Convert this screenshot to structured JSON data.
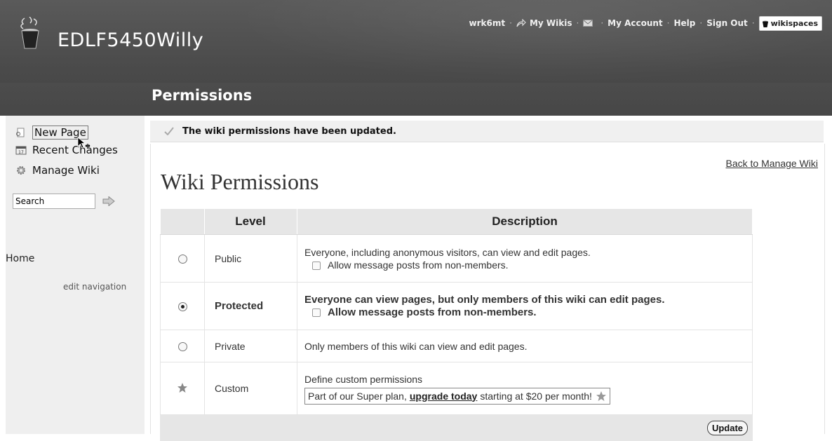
{
  "header": {
    "site_title": "EDLF5450Willy",
    "page_heading": "Permissions",
    "user_nav": {
      "username": "wrk6mt",
      "my_wikis": "My Wikis",
      "my_account": "My Account",
      "help": "Help",
      "sign_out": "Sign Out",
      "brand": "wikispaces"
    }
  },
  "sidebar": {
    "new_page": "New Page",
    "recent_changes": "Recent Changes",
    "manage_wiki": "Manage Wiki",
    "search_value": "Search",
    "home": "Home",
    "edit_navigation": "edit navigation"
  },
  "notice": {
    "message": "The wiki permissions have been updated."
  },
  "main": {
    "back_link": "Back to Manage Wiki",
    "title": "Wiki Permissions",
    "table": {
      "col_level": "Level",
      "col_description": "Description",
      "rows": [
        {
          "level": "Public",
          "selected": false,
          "description": "Everyone, including anonymous visitors, can view and edit pages.",
          "checkbox_label": "Allow message posts from non-members."
        },
        {
          "level": "Protected",
          "selected": true,
          "description": "Everyone can view pages, but only members of this wiki can edit pages.",
          "checkbox_label": "Allow message posts from non-members."
        },
        {
          "level": "Private",
          "selected": false,
          "description": "Only members of this wiki can view and edit pages."
        },
        {
          "level": "Custom",
          "description": "Define custom permissions",
          "upgrade_prefix": "Part of our Super plan,",
          "upgrade_link": "upgrade today",
          "upgrade_suffix": "starting at $20 per month!"
        }
      ]
    },
    "update_button": "Update"
  },
  "colors": {
    "header_bg": "#4a4a4a",
    "sidebar_bg": "#efefef",
    "table_header_bg": "#e6e6e6"
  }
}
